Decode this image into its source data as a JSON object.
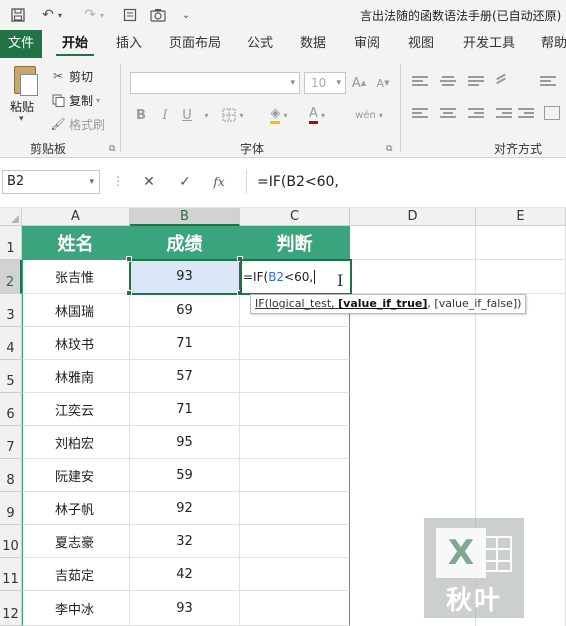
{
  "title_bar": {
    "document_title": "言出法随的函数语法手册(已自动还原)",
    "icons": [
      "save-icon",
      "undo-icon",
      "redo-icon",
      "print-preview-icon",
      "camera-icon",
      "customize-toolbar-icon"
    ]
  },
  "ribbon_tabs": [
    "文件",
    "开始",
    "插入",
    "页面布局",
    "公式",
    "数据",
    "审阅",
    "视图",
    "开发工具",
    "帮助"
  ],
  "active_tab": "开始",
  "ribbon": {
    "clipboard": {
      "paste_label": "粘贴",
      "cut_label": "剪切",
      "copy_label": "复制",
      "format_painter_label": "格式刷",
      "group_label": "剪贴板"
    },
    "font": {
      "font_name_value": "",
      "font_size_value": "10",
      "group_label": "字体",
      "bold": "B",
      "italic": "I",
      "underline": "U",
      "font_color": "A",
      "phonetic": "wén"
    },
    "alignment": {
      "group_label": "对齐方式"
    }
  },
  "formula_bar": {
    "name_box": "B2",
    "dots": "⋮",
    "fx_label": "fx",
    "formula": "=IF(B2<60,"
  },
  "columns": [
    "A",
    "B",
    "C",
    "D",
    "E"
  ],
  "rows": [
    "1",
    "2",
    "3",
    "4",
    "5",
    "6",
    "7",
    "8",
    "9",
    "10",
    "11",
    "12"
  ],
  "table": {
    "headers": [
      "姓名",
      "成绩",
      "判断"
    ],
    "records": [
      {
        "name": "张吉惟",
        "score": "93"
      },
      {
        "name": "林国瑞",
        "score": "69"
      },
      {
        "name": "林玟书",
        "score": "71"
      },
      {
        "name": "林雅南",
        "score": "57"
      },
      {
        "name": "江奕云",
        "score": "71"
      },
      {
        "name": "刘柏宏",
        "score": "95"
      },
      {
        "name": "阮建安",
        "score": "59"
      },
      {
        "name": "林子帆",
        "score": "92"
      },
      {
        "name": "夏志豪",
        "score": "32"
      },
      {
        "name": "吉茹定",
        "score": "42"
      },
      {
        "name": "李中冰",
        "score": "93"
      }
    ]
  },
  "editing_cell": {
    "prefix": "=IF(",
    "ref": "B2",
    "suffix": "<60,"
  },
  "tooltip": {
    "part1": "IF(logical_test, ",
    "current_arg": "[value_if_true]",
    "part2": ", [value_if_false])"
  },
  "watermark": {
    "logo_letter": "X",
    "text": "秋叶"
  },
  "colors": {
    "excel_green": "#217346",
    "header_fill": "#3aa47d",
    "selected_cell_fill": "#dbe6f6",
    "reference_blue": "#2f6fde"
  }
}
